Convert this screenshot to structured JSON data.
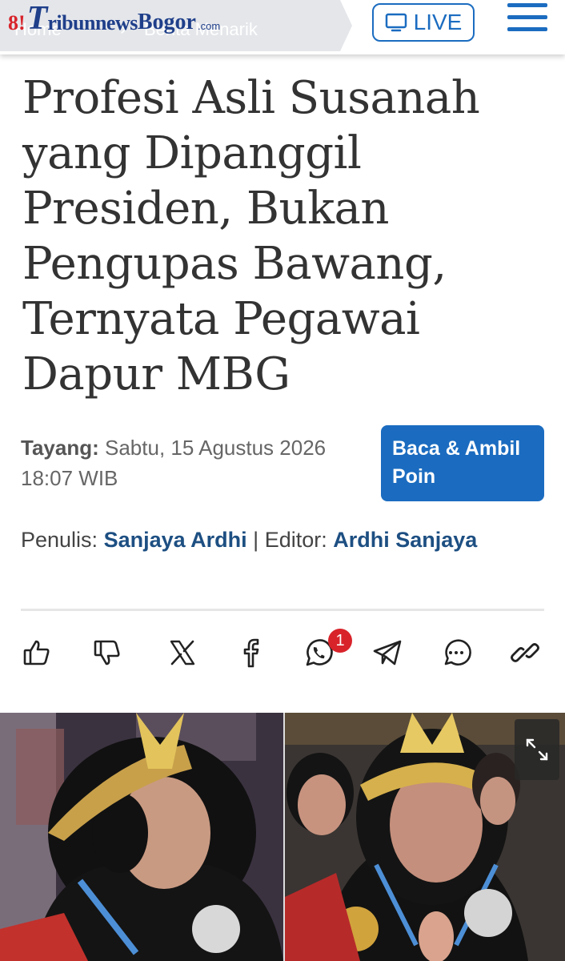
{
  "header": {
    "breadcrumb": {
      "home": "Home",
      "separator": "›",
      "category": "Berita Menarik"
    },
    "logo": {
      "mark": "8!",
      "t": "T",
      "ribun": "ribunnews",
      "bogor": "Bogor",
      "com": ".com"
    },
    "live_label": "LIVE",
    "icons": {
      "live": "tv-icon",
      "menu": "hamburger-menu-icon"
    }
  },
  "article": {
    "title": "Profesi Asli Susanah yang Dipanggil Presiden, Bukan Pengupas Bawang, Ternyata Pegawai Dapur MBG",
    "published_label": "Tayang:",
    "published_value": "Sabtu, 15 Agustus 2026 18:07 WIB",
    "cta_label": "Baca & Ambil Poin",
    "writer_label": "Penulis:",
    "writer_name": "Sanjaya Ardhi",
    "authors_sep": "|",
    "editor_label": "Editor:",
    "editor_name": "Ardhi Sanjaya"
  },
  "actions": {
    "items": [
      "like-icon",
      "dislike-icon",
      "x-twitter-icon",
      "facebook-icon",
      "whatsapp-icon",
      "telegram-icon",
      "comment-icon",
      "copy-link-icon"
    ],
    "whatsapp_badge": "1"
  },
  "photo": {
    "expand_icon": "expand-icon"
  },
  "colors": {
    "accent": "#1b6cc0",
    "brand_blue": "#1f3f8a",
    "brand_red": "#d8232a",
    "author_link": "#1d4f82"
  }
}
